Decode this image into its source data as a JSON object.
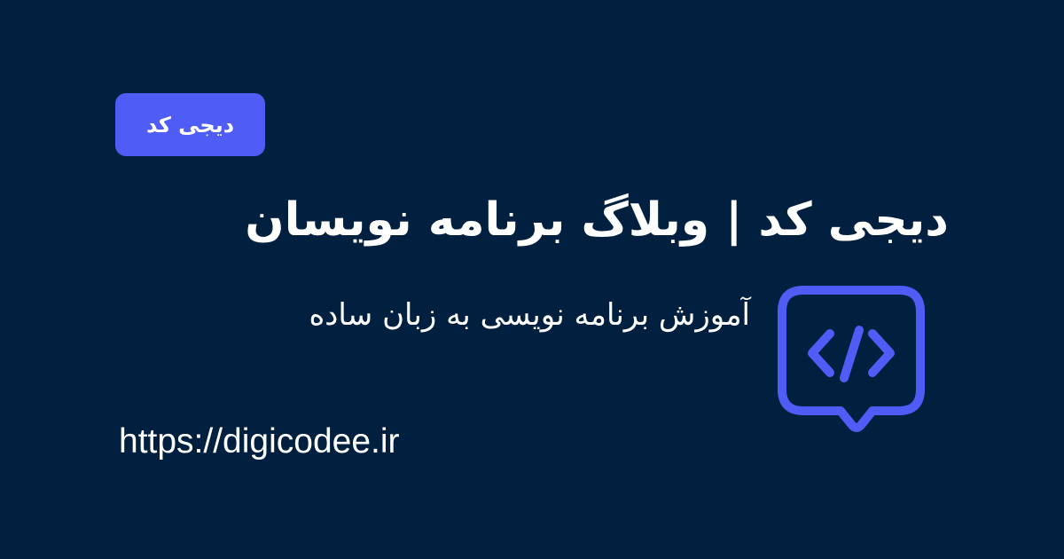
{
  "badge": {
    "label": "دیجی کد"
  },
  "heading": {
    "title": "دیجی کد | وبلاگ برنامه نویسان"
  },
  "tagline": {
    "text": "آموزش برنامه نویسی به زبان ساده"
  },
  "site": {
    "url": "https://digicodee.ir"
  },
  "logo": {
    "icon": "code-chat-bubble-icon"
  },
  "colors": {
    "background": "#01203f",
    "accent": "#4f5cf6",
    "text": "#ffffff"
  }
}
